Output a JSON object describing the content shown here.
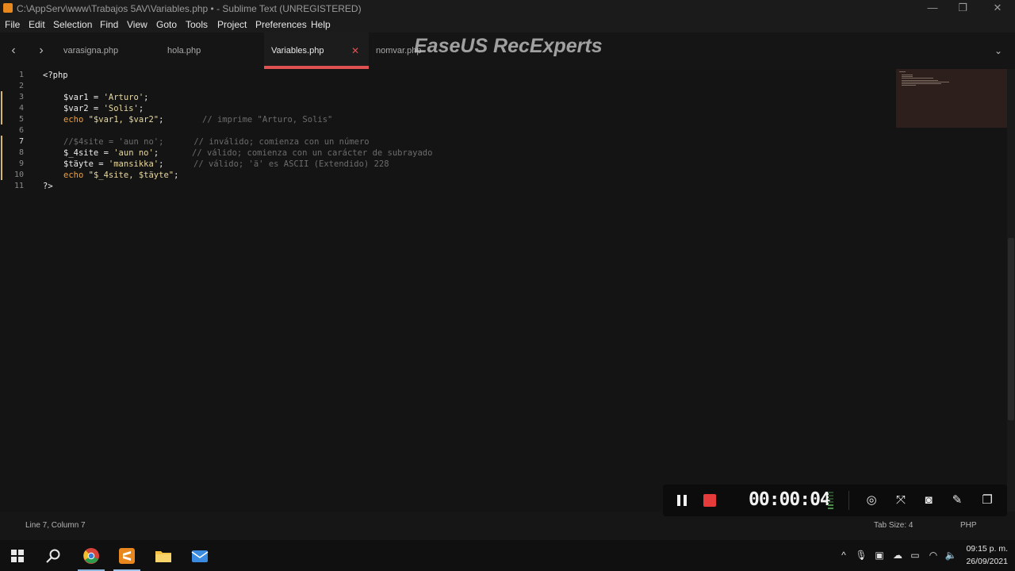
{
  "window": {
    "title": "C:\\AppServ\\www\\Trabajos 5AV\\Variables.php • - Sublime Text (UNREGISTERED)",
    "minimize": "—",
    "maximize": "❐",
    "close": "✕"
  },
  "menu": [
    "File",
    "Edit",
    "Selection",
    "Find",
    "View",
    "Goto",
    "Tools",
    "Project",
    "Preferences",
    "Help"
  ],
  "tabs": {
    "back": "‹",
    "forward": "›",
    "items": [
      {
        "label": "varasigna.php"
      },
      {
        "label": "hola.php"
      },
      {
        "label": "Variables.php",
        "active": true,
        "close": "✕"
      },
      {
        "label": "nomvar.php"
      }
    ],
    "dropdown": "⌄"
  },
  "watermark": "EaseUS RecExperts",
  "editor": {
    "line_numbers": [
      "1",
      "2",
      "3",
      "4",
      "5",
      "6",
      "7",
      "8",
      "9",
      "10",
      "11"
    ],
    "current_line": 7,
    "code": {
      "l1": "<?php",
      "l3_var": "$var1",
      "l3_eq": " = ",
      "l3_str": "'Arturo'",
      "l3_end": ";",
      "l4_var": "$var2",
      "l4_eq": " = ",
      "l4_str": "'Solis'",
      "l4_end": ";",
      "l5_kw": "echo",
      "l5_str": " \"$var1, $var2\"",
      "l5_end": ";",
      "l5_cm": "// imprime \"Arturo, Solis\"",
      "l7_cm": "//$4site = 'aun no';      // inválido; comienza con un número",
      "l8_var": "$_4site",
      "l8_eq": " = ",
      "l8_str": "'aun no'",
      "l8_end": ";",
      "l8_cm": "// válido; comienza con un carácter de subrayado",
      "l9_var": "$täyte",
      "l9_eq": " = ",
      "l9_str": "'mansikka'",
      "l9_end": ";",
      "l9_cm": "// válido; 'ä' es ASCII (Extendido) 228",
      "l10_kw": "echo",
      "l10_str": " \"$_4site, $täyte\"",
      "l10_end": ";",
      "l11": "?>"
    }
  },
  "status": {
    "position": "Line 7, Column 7",
    "tab_size": "Tab Size: 4",
    "syntax": "PHP"
  },
  "recorder": {
    "time": "00:00:04",
    "icons": [
      "screenshot-region-icon",
      "fullscreen-icon",
      "camera-icon",
      "pen-icon",
      "minimize-window-icon"
    ]
  },
  "taskbar": {
    "time": "09:15 p. m.",
    "date": "26/09/2021"
  },
  "colors": {
    "accent_tab": "#e05252",
    "keyword": "#f0a03c",
    "string": "#e8d9a0",
    "comment": "#6c6c6c",
    "record": "#e63b3b"
  }
}
